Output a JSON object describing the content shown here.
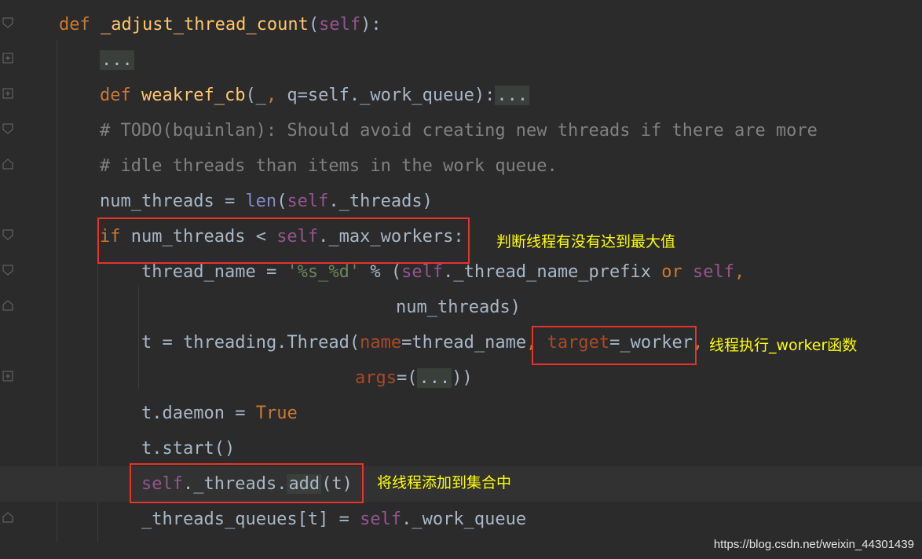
{
  "colors": {
    "background": "#2b2b2b",
    "keyword": "#cc7832",
    "function": "#ffc66d",
    "self": "#94558d",
    "builtin": "#8888c6",
    "comment": "#808080",
    "string": "#6a8759",
    "kwarg": "#aa4926",
    "annotation": "#ffff00",
    "highlight_box": "#e8322a"
  },
  "code_lines": [
    {
      "tokens": [
        [
          "kw",
          "def "
        ],
        [
          "fn",
          "_adjust_thread_count"
        ],
        [
          "plain",
          "("
        ],
        [
          "self",
          "self"
        ],
        [
          "plain",
          "):"
        ]
      ]
    },
    {
      "tokens": [
        [
          "collapsed",
          "..."
        ]
      ]
    },
    {
      "tokens": [
        [
          "kw",
          "def "
        ],
        [
          "fn",
          "weakref_cb"
        ],
        [
          "plain",
          "(_"
        ],
        [
          "kw",
          ","
        ],
        [
          "plain",
          " q=self._work_queue):"
        ],
        [
          "collapsed",
          "..."
        ]
      ]
    },
    {
      "tokens": [
        [
          "cmt",
          "# TODO(bquinlan): Should avoid creating new threads if there are more"
        ]
      ]
    },
    {
      "tokens": [
        [
          "cmt",
          "# idle threads than items in the work queue."
        ]
      ]
    },
    {
      "tokens": [
        [
          "plain",
          "num_threads = "
        ],
        [
          "bi",
          "len"
        ],
        [
          "plain",
          "("
        ],
        [
          "self",
          "self"
        ],
        [
          "plain",
          "._threads)"
        ]
      ]
    },
    {
      "tokens": [
        [
          "kw",
          "if "
        ],
        [
          "plain",
          "num_threads < "
        ],
        [
          "self",
          "self"
        ],
        [
          "plain",
          "._max_workers:"
        ]
      ]
    },
    {
      "tokens": [
        [
          "plain",
          "thread_name = "
        ],
        [
          "str",
          "'%s_%d'"
        ],
        [
          "plain",
          " % ("
        ],
        [
          "self",
          "self"
        ],
        [
          "plain",
          "._thread_name_prefix "
        ],
        [
          "kw",
          "or "
        ],
        [
          "self",
          "self"
        ],
        [
          "kw",
          ","
        ]
      ]
    },
    {
      "tokens": [
        [
          "plain",
          "num_threads)"
        ]
      ]
    },
    {
      "tokens": [
        [
          "plain",
          "t = threading.Thread("
        ],
        [
          "kwarg",
          "name"
        ],
        [
          "plain",
          "=thread_name"
        ],
        [
          "kw",
          ", "
        ],
        [
          "kwarg",
          "target"
        ],
        [
          "plain",
          "=_worker"
        ],
        [
          "kw",
          ","
        ]
      ]
    },
    {
      "tokens": [
        [
          "kwarg",
          "args"
        ],
        [
          "plain",
          "=("
        ],
        [
          "collapsed",
          "..."
        ],
        [
          "plain",
          "))"
        ]
      ]
    },
    {
      "tokens": [
        [
          "plain",
          "t.daemon = "
        ],
        [
          "kw",
          "True"
        ]
      ]
    },
    {
      "tokens": [
        [
          "plain",
          "t.start()"
        ]
      ]
    },
    {
      "tokens": [
        [
          "self",
          "self"
        ],
        [
          "plain",
          "._threads."
        ],
        [
          "collapsed",
          "add"
        ],
        [
          "plain",
          "(t)"
        ]
      ]
    },
    {
      "tokens": [
        [
          "plain",
          "_threads_queues[t] = "
        ],
        [
          "self",
          "self"
        ],
        [
          "plain",
          "._work_queue"
        ]
      ]
    }
  ],
  "annotations": [
    {
      "text": "判断线程有没有达到最大值"
    },
    {
      "text": "线程执行_worker函数"
    },
    {
      "text": "将线程添加到集合中"
    }
  ],
  "watermark": "https://blog.csdn.net/weixin_44301439",
  "fold_icons": [
    "fold-open-icon",
    "fold-closed-icon",
    "fold-closed-icon",
    "fold-open-icon",
    "fold-end-icon",
    "fold-open-icon",
    "fold-open-icon",
    "fold-end-icon",
    "fold-closed-icon",
    "fold-end-icon"
  ]
}
